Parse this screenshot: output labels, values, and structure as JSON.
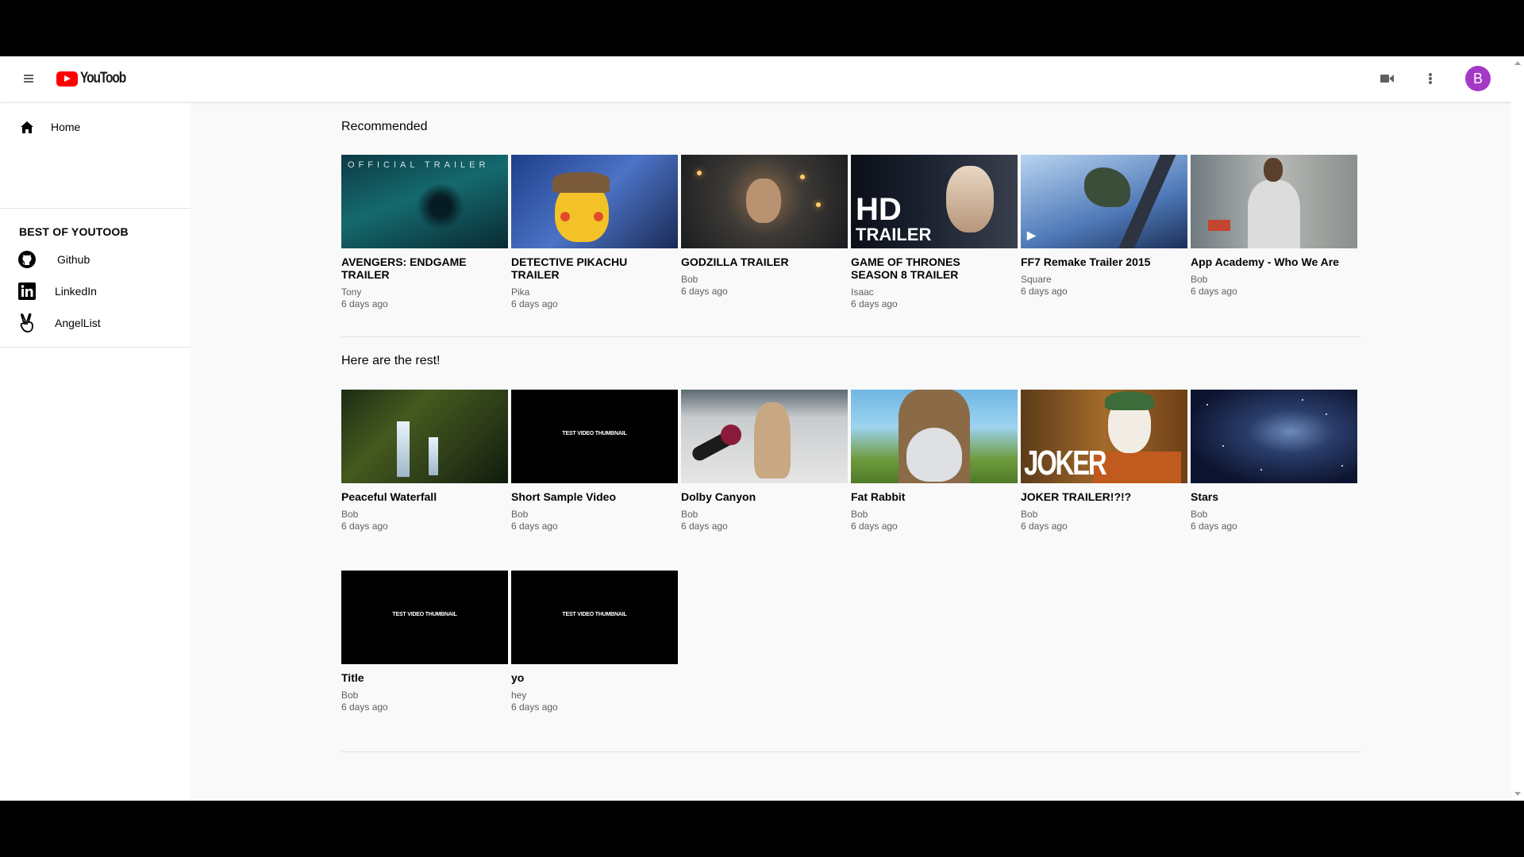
{
  "app": {
    "logo_text": "YouToob",
    "avatar_letter": "B",
    "accent": "#ff0000",
    "avatar_color": "#a439c6"
  },
  "header": {
    "icons": [
      "menu-icon",
      "video-camera-icon",
      "more-vert-icon"
    ]
  },
  "sidebar": {
    "home": {
      "label": "Home",
      "icon": "home-icon"
    },
    "heading": "BEST OF YOUTOOB",
    "links": [
      {
        "label": "Github",
        "icon": "github-icon"
      },
      {
        "label": "LinkedIn",
        "icon": "linkedin-icon"
      },
      {
        "label": "AngelList",
        "icon": "angellist-icon"
      }
    ]
  },
  "recommended": {
    "title": "Recommended",
    "videos": [
      {
        "title": "AVENGERS: ENDGAME TRAILER",
        "channel": "Tony",
        "age": "6 days ago",
        "thumb_text": "OFFICIAL TRAILER"
      },
      {
        "title": "DETECTIVE PIKACHU TRAILER",
        "channel": "Pika",
        "age": "6 days ago"
      },
      {
        "title": "GODZILLA TRAILER",
        "channel": "Bob",
        "age": "6 days ago"
      },
      {
        "title": "GAME OF THRONES SEASON 8 TRAILER",
        "channel": "Isaac",
        "age": "6 days ago",
        "thumb_text_1": "HD",
        "thumb_text_2": "TRAILER"
      },
      {
        "title": "FF7 Remake Trailer 2015",
        "channel": "Square",
        "age": "6 days ago"
      },
      {
        "title": "App Academy - Who We Are",
        "channel": "Bob",
        "age": "6 days ago"
      }
    ]
  },
  "rest": {
    "title": "Here are the rest!",
    "videos": [
      {
        "title": "Peaceful Waterfall",
        "channel": "Bob",
        "age": "6 days ago"
      },
      {
        "title": "Short Sample Video",
        "channel": "Bob",
        "age": "6 days ago",
        "thumb_text": "TEST VIDEO THUMBNAIL"
      },
      {
        "title": "Dolby Canyon",
        "channel": "Bob",
        "age": "6 days ago"
      },
      {
        "title": "Fat Rabbit",
        "channel": "Bob",
        "age": "6 days ago"
      },
      {
        "title": "JOKER TRAILER!?!?",
        "channel": "Bob",
        "age": "6 days ago",
        "thumb_text": "JOKER"
      },
      {
        "title": "Stars",
        "channel": "Bob",
        "age": "6 days ago"
      },
      {
        "title": "Title",
        "channel": "Bob",
        "age": "6 days ago",
        "thumb_text": "TEST VIDEO THUMBNAIL"
      },
      {
        "title": "yo",
        "channel": "hey",
        "age": "6 days ago",
        "thumb_text": "TEST VIDEO THUMBNAIL"
      }
    ]
  }
}
